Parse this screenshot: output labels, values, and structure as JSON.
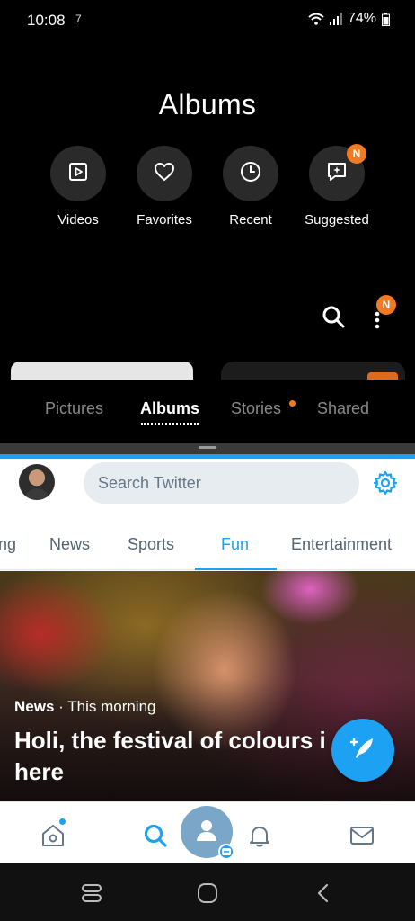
{
  "status_bar": {
    "time": "10:08",
    "notification": "7",
    "battery": "74%"
  },
  "gallery": {
    "title": "Albums",
    "shortcuts": [
      {
        "label": "Videos",
        "icon": "video-icon"
      },
      {
        "label": "Favorites",
        "icon": "heart-icon"
      },
      {
        "label": "Recent",
        "icon": "clock-icon"
      },
      {
        "label": "Suggested",
        "icon": "suggested-icon",
        "badge": "N"
      }
    ],
    "menu_badge": "N",
    "tabs": [
      "Pictures",
      "Albums",
      "Stories",
      "Shared"
    ],
    "active_tab": "Albums"
  },
  "twitter": {
    "search_placeholder": "Search Twitter",
    "tabs": [
      "ng",
      "News",
      "Sports",
      "Fun",
      "Entertainment"
    ],
    "active_tab": "Fun",
    "hero": {
      "source": "News",
      "separator": " · ",
      "time": "This morning",
      "title_line1": "Holi, the festival of colours i",
      "title_line2": "here"
    },
    "bottom_nav": [
      "home-icon",
      "search-icon",
      "account-icon",
      "bell-icon",
      "mail-icon"
    ],
    "accent": "#1da1f2"
  },
  "colors": {
    "gallery_accent": "#f07b22",
    "twitter_blue": "#1da1f2"
  }
}
